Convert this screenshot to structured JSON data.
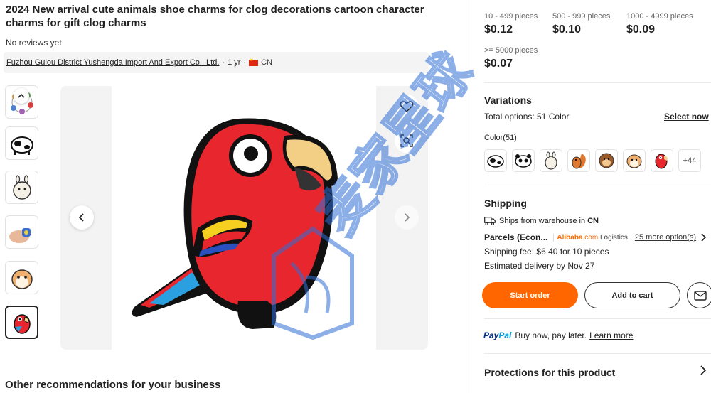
{
  "product": {
    "title": "2024 New arrival cute animals shoe charms for clog decorations cartoon character charms for gift clog charms",
    "reviews": "No reviews yet"
  },
  "supplier": {
    "name": "Fuzhou Gulou District Yushengda Import And Export Co., Ltd.",
    "years": "1 yr",
    "country": "CN"
  },
  "gallery": {
    "thumbnails": [
      "cow-charm",
      "llama-charm",
      "hand-charm",
      "hamster-charm",
      "parrot-charm"
    ],
    "active_index": 4
  },
  "pricing": {
    "tiers": [
      {
        "qty": "10 - 499 pieces",
        "price": "$0.12"
      },
      {
        "qty": "500 - 999 pieces",
        "price": "$0.10"
      },
      {
        "qty": "1000 - 4999 pieces",
        "price": "$0.09"
      },
      {
        "qty": ">= 5000 pieces",
        "price": "$0.07"
      }
    ]
  },
  "variations": {
    "heading": "Variations",
    "total": "Total options: 51 Color.",
    "select_now": "Select now",
    "color_label": "Color(51)",
    "swatches": [
      "cow",
      "panda",
      "llama",
      "squirrel",
      "monkey",
      "hamster",
      "parrot"
    ],
    "more": "+44"
  },
  "shipping": {
    "heading": "Shipping",
    "ships_from": "Ships from warehouse in",
    "ships_from_country": "CN",
    "method": "Parcels (Econ...",
    "logistics_brand": "Alibaba",
    "logistics_suffix": ".com",
    "logistics_word": "Logistics",
    "more_options": "25 more option(s)",
    "fee": "Shipping fee: $6.40 for 10 pieces",
    "delivery": "Estimated delivery by Nov 27"
  },
  "actions": {
    "start_order": "Start order",
    "add_to_cart": "Add to cart"
  },
  "paypal": {
    "logo_pay": "Pay",
    "logo_pal": "Pal",
    "text": "Buy now, pay later.",
    "learn_more": "Learn more"
  },
  "protections": {
    "heading": "Protections for this product"
  },
  "recommendations": {
    "heading": "Other recommendations for your business"
  },
  "watermark": {
    "text": "麦家星球"
  },
  "colors": {
    "accent": "#ff6600",
    "parrot_red": "#e8262d",
    "watermark_blue": "#2f6fd6"
  }
}
